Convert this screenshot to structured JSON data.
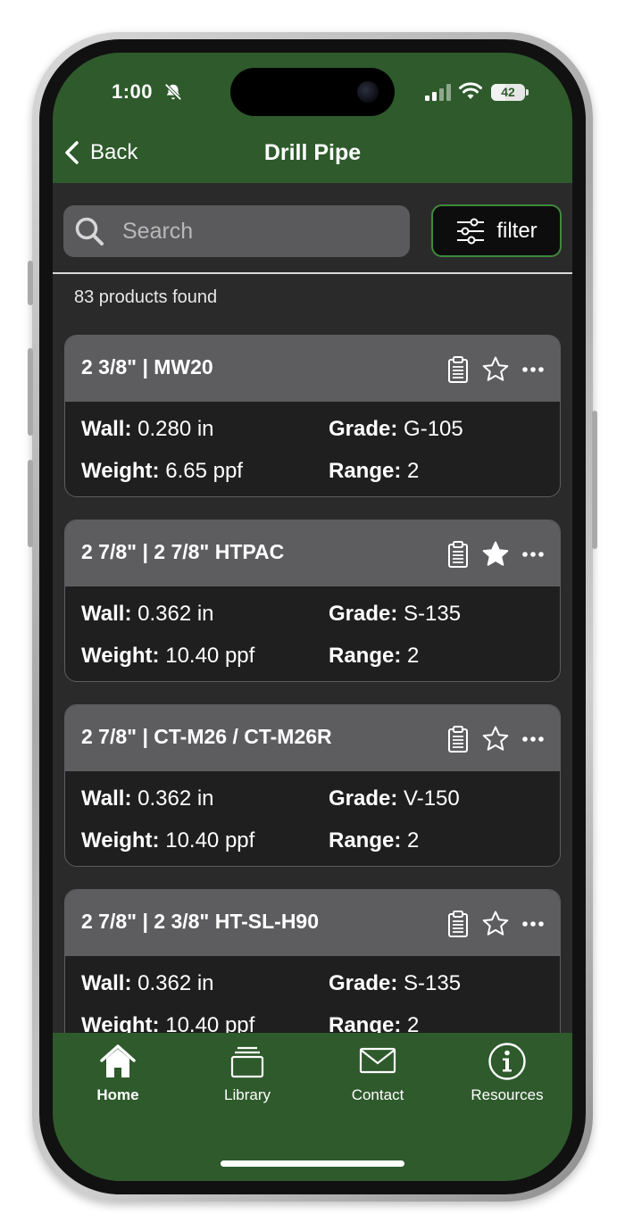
{
  "status_bar": {
    "time": "1:00",
    "battery": "42",
    "battery_level": 0.42
  },
  "header": {
    "back_label": "Back",
    "title": "Drill Pipe"
  },
  "search": {
    "placeholder": "Search",
    "value": ""
  },
  "filter": {
    "label": "filter"
  },
  "results": {
    "count_text": "83 products found"
  },
  "labels": {
    "wall": "Wall:",
    "grade": "Grade:",
    "weight": "Weight:",
    "range": "Range:"
  },
  "products": [
    {
      "title": "2 3/8\" | MW20",
      "wall": "0.280 in",
      "grade": "G-105",
      "weight": "6.65 ppf",
      "range": "2",
      "favorite": false
    },
    {
      "title": "2 7/8\" | 2 7/8\" HTPAC",
      "wall": "0.362 in",
      "grade": "S-135",
      "weight": "10.40 ppf",
      "range": "2",
      "favorite": true
    },
    {
      "title": "2 7/8\" | CT-M26 / CT-M26R",
      "wall": "0.362 in",
      "grade": "V-150",
      "weight": "10.40 ppf",
      "range": "2",
      "favorite": false
    },
    {
      "title": "2 7/8\" | 2 3/8\" HT-SL-H90",
      "wall": "0.362 in",
      "grade": "S-135",
      "weight": "10.40 ppf",
      "range": "2",
      "favorite": false
    }
  ],
  "tabs": [
    {
      "label": "Home",
      "icon": "home-icon",
      "active": true
    },
    {
      "label": "Library",
      "icon": "library-icon",
      "active": false
    },
    {
      "label": "Contact",
      "icon": "mail-icon",
      "active": false
    },
    {
      "label": "Resources",
      "icon": "info-icon",
      "active": false
    }
  ],
  "colors": {
    "brand_green": "#2e5a2c",
    "card_header": "#5d5d60",
    "background": "#2a2a2b",
    "filter_border": "#3f8a3c"
  }
}
